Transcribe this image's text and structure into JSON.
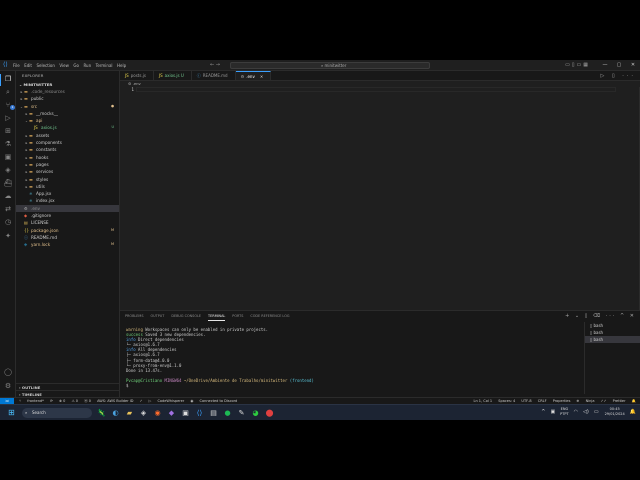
{
  "window": {
    "menu": [
      "File",
      "Edit",
      "Selection",
      "View",
      "Go",
      "Run",
      "Terminal",
      "Help"
    ],
    "search": "minitwitter"
  },
  "activity": {
    "badge_count": "1"
  },
  "explorer": {
    "header": "EXPLORER",
    "project": "MINITWITTER",
    "tree": [
      {
        "name": ".code_resources",
        "depth": 1,
        "kind": "folder",
        "color": "gray"
      },
      {
        "name": "public",
        "depth": 1,
        "kind": "folder"
      },
      {
        "name": "src",
        "depth": 1,
        "kind": "folder-open",
        "status": "●",
        "color": "yellow"
      },
      {
        "name": "__mocks__",
        "depth": 2,
        "kind": "folder"
      },
      {
        "name": "api",
        "depth": 2,
        "kind": "folder-open",
        "color": "yellow"
      },
      {
        "name": "axios.js",
        "depth": 3,
        "kind": "js",
        "status": "U",
        "color": "green"
      },
      {
        "name": "assets",
        "depth": 2,
        "kind": "folder"
      },
      {
        "name": "components",
        "depth": 2,
        "kind": "folder"
      },
      {
        "name": "constants",
        "depth": 2,
        "kind": "folder"
      },
      {
        "name": "hooks",
        "depth": 2,
        "kind": "folder"
      },
      {
        "name": "pages",
        "depth": 2,
        "kind": "folder"
      },
      {
        "name": "services",
        "depth": 2,
        "kind": "folder"
      },
      {
        "name": "styles",
        "depth": 2,
        "kind": "folder"
      },
      {
        "name": "utils",
        "depth": 2,
        "kind": "folder"
      },
      {
        "name": "App.jsx",
        "depth": 2,
        "kind": "react"
      },
      {
        "name": "index.jsx",
        "depth": 2,
        "kind": "react"
      },
      {
        "name": ".env",
        "depth": 1,
        "kind": "env",
        "selected": true,
        "color": "gray"
      },
      {
        "name": ".gitignore",
        "depth": 1,
        "kind": "git"
      },
      {
        "name": "LICENSE",
        "depth": 1,
        "kind": "license"
      },
      {
        "name": "package.json",
        "depth": 1,
        "kind": "json",
        "status": "M",
        "color": "yellow"
      },
      {
        "name": "README.md",
        "depth": 1,
        "kind": "md"
      },
      {
        "name": "yarn.lock",
        "depth": 1,
        "kind": "yarn",
        "status": "M",
        "color": "yellow"
      }
    ],
    "sections": [
      "OUTLINE",
      "TIMELINE"
    ]
  },
  "tabs": [
    {
      "label": "posts.js",
      "icon": "JS",
      "active": false
    },
    {
      "label": "axios.js",
      "icon": "JS",
      "active": false,
      "modified": "U"
    },
    {
      "label": "README.md",
      "icon": "ⓘ",
      "active": false
    },
    {
      "label": ".env",
      "icon": "⚙",
      "active": true
    }
  ],
  "editor": {
    "breadcrumb": "⚙ .env",
    "line_numbers": [
      "1"
    ]
  },
  "panel": {
    "tabs": [
      "PROBLEMS",
      "OUTPUT",
      "DEBUG CONSOLE",
      "TERMINAL",
      "PORTS",
      "CODE REFERENCE LOG"
    ],
    "active_tab": "TERMINAL",
    "terminal_lines": [
      {
        "parts": [
          {
            "t": "warning",
            "c": "t-yel"
          },
          {
            "t": " Workspaces can only be enabled in private projects.",
            "c": ""
          }
        ]
      },
      {
        "parts": [
          {
            "t": "success",
            "c": "t-green"
          },
          {
            "t": " Saved 3 new dependencies.",
            "c": ""
          }
        ]
      },
      {
        "parts": [
          {
            "t": "info",
            "c": "t-blue"
          },
          {
            "t": " Direct dependencies",
            "c": ""
          }
        ]
      },
      {
        "parts": [
          {
            "t": "└─ axios@1.6.7",
            "c": ""
          }
        ]
      },
      {
        "parts": [
          {
            "t": "info",
            "c": "t-blue"
          },
          {
            "t": " All dependencies",
            "c": ""
          }
        ]
      },
      {
        "parts": [
          {
            "t": "├─ axios@1.6.7",
            "c": ""
          }
        ]
      },
      {
        "parts": [
          {
            "t": "├─ form-data@4.0.0",
            "c": ""
          }
        ]
      },
      {
        "parts": [
          {
            "t": "└─ proxy-from-env@1.1.0",
            "c": ""
          }
        ]
      },
      {
        "parts": [
          {
            "t": "Done in 13.47s.",
            "c": ""
          }
        ]
      },
      {
        "parts": [
          {
            "t": " ",
            "c": ""
          }
        ]
      },
      {
        "parts": [
          {
            "t": "Pvcap@Cristiano",
            "c": "t-green"
          },
          {
            "t": " MINGW64 ",
            "c": "t-mag"
          },
          {
            "t": "~/OneDrive/Ambiente de Trabalho/minitwitter",
            "c": "t-yel"
          },
          {
            "t": " (frontend)",
            "c": "t-cyan"
          }
        ]
      },
      {
        "parts": [
          {
            "t": "$ ",
            "c": ""
          }
        ]
      }
    ],
    "terminals": [
      "bash",
      "bash",
      "bash"
    ]
  },
  "status": {
    "branch": "frontend*",
    "sync": "⟳",
    "errors": "⊗ 0",
    "warnings": "⚠ 0",
    "ports": "ⓦ 0",
    "aws": "AWS: AWS Builder ID",
    "prettier_left": "✓",
    "codewhisperer": "CodeWhisperer",
    "connected": "Connected to Discord",
    "cursor": "Ln 1, Col 1",
    "spaces": "Spaces: 4",
    "encoding": "UTF-8",
    "eol": "CRLF",
    "language": "Properties",
    "ninja": "Ninja",
    "prettier": "Prettier"
  },
  "taskbar": {
    "search": "Search",
    "lang": "ENG",
    "region": "PTPT",
    "time": "00:45",
    "date": "29/01/2024"
  }
}
